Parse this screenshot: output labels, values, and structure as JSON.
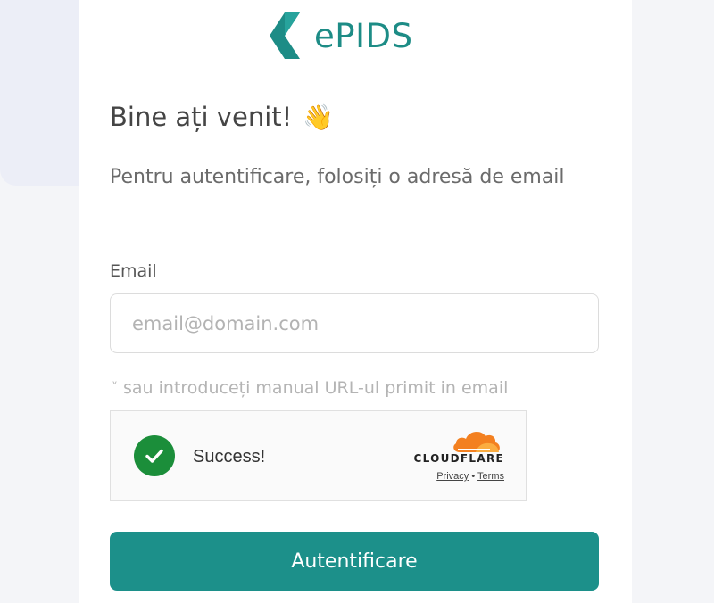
{
  "brand": {
    "name": "ePIDS",
    "color": "#1d8c86"
  },
  "welcome": {
    "title": "Bine ați venit!",
    "emoji": "👋"
  },
  "subtitle": "Pentru autentificare, folosiți o adresă de email",
  "email": {
    "label": "Email",
    "placeholder": "email@domain.com",
    "value": ""
  },
  "manual_url": {
    "chevron": "˅",
    "label": "sau introduceți manual URL-ul primit in email"
  },
  "captcha": {
    "status": "Success!",
    "provider": "CLOUDFLARE",
    "privacy": "Privacy",
    "separator": "•",
    "terms": "Terms",
    "status_color": "#1b8e3a",
    "provider_color": "#f38020"
  },
  "submit": {
    "label": "Autentificare",
    "color": "#1c908a"
  }
}
